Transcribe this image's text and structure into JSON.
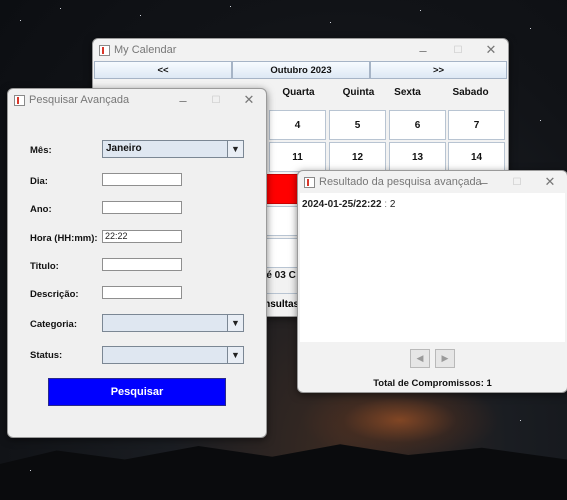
{
  "calendar": {
    "title": "My Calendar",
    "prev_label": "<<",
    "month_label": "Outubro 2023",
    "next_label": ">>",
    "day_headers": [
      "Quarta",
      "Quinta",
      "Sexta",
      "Sabado"
    ],
    "week_row_1": [
      "4",
      "5",
      "6",
      "7"
    ],
    "week_row_2": [
      "11",
      "12",
      "13",
      "14"
    ],
    "status_partial": "e é 03 C",
    "consultas_partial": "onsultas",
    "highlight_color": "#ff0000"
  },
  "search": {
    "title": "Pesquisar Avançada",
    "mes_label": "Mês:",
    "mes_value": "Janeiro",
    "dia_label": "Dia:",
    "dia_value": "",
    "ano_label": "Ano:",
    "ano_value": "",
    "hora_label": "Hora (HH:mm):",
    "hora_value": "22:22",
    "titulo_label": "Titulo:",
    "titulo_value": "",
    "descricao_label": "Descrição:",
    "descricao_value": "",
    "categoria_label": "Categoria:",
    "categoria_value": "",
    "status_label": "Status:",
    "status_value": "",
    "button_label": "Pesquisar",
    "button_color": "#0000ff"
  },
  "result": {
    "title": "Resultado da pesquisa avançada",
    "entry_key": "2024-01-25/22:22",
    "entry_sep": " : ",
    "entry_value": "2",
    "prev_icon": "play-left-icon",
    "next_icon": "play-right-icon",
    "total_label": "Total de Compromissos: 1"
  },
  "window_controls": {
    "minimize": "–",
    "maximize": "☐",
    "close": "✕"
  }
}
